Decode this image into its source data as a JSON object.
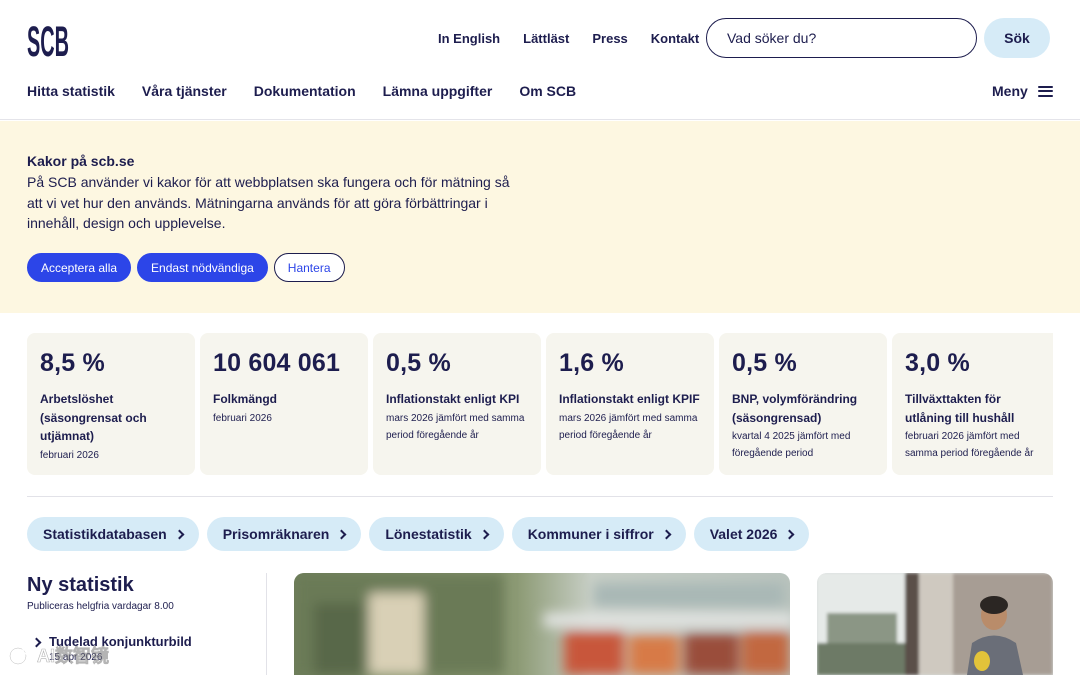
{
  "header": {
    "logo_text": "SCB",
    "top_links": [
      "In English",
      "Lättläst",
      "Press",
      "Kontakt"
    ],
    "search": {
      "placeholder": "Vad söker du?",
      "button": "Sök"
    },
    "nav": [
      "Hitta statistik",
      "Våra tjänster",
      "Dokumentation",
      "Lämna uppgifter",
      "Om SCB"
    ],
    "menu_label": "Meny"
  },
  "cookie": {
    "title": "Kakor på scb.se",
    "text": "På SCB använder vi kakor för att webbplatsen ska fungera och för mätning så att vi vet hur den används. Mätningarna används för att göra förbättringar i innehåll, design och upplevelse.",
    "buttons": [
      "Acceptera alla",
      "Endast nödvändiga",
      "Hantera"
    ]
  },
  "stats": [
    {
      "value": "8,5 %",
      "label": "Arbetslöshet (säsongrensat och utjämnat)",
      "sub": "februari 2026"
    },
    {
      "value": "10 604 061",
      "label": "Folkmängd",
      "sub": "februari 2026"
    },
    {
      "value": "0,5 %",
      "label": "Inflationstakt enligt KPI",
      "sub": "mars 2026 jämfört med samma period föregående år"
    },
    {
      "value": "1,6 %",
      "label": "Inflationstakt enligt KPIF",
      "sub": "mars 2026 jämfört med samma period föregående år"
    },
    {
      "value": "0,5 %",
      "label": "BNP, volymförändring (säsongrensad)",
      "sub": "kvartal 4 2025 jämfört med föregående period"
    },
    {
      "value": "3,0 %",
      "label": "Tillväxttakten för utlåning till hushåll",
      "sub": "februari 2026 jämfört med samma period föregående år"
    }
  ],
  "quick_links": [
    "Statistikdatabasen",
    "Prisomräknaren",
    "Lönestatistik",
    "Kommuner i siffror",
    "Valet 2026"
  ],
  "news": {
    "title": "Ny statistik",
    "subtitle": "Publiceras helgfria vardagar 8.00",
    "items": [
      {
        "title": "Tudelad konjunkturbild",
        "date": "15 apr 2026"
      }
    ]
  },
  "watermark": {
    "text": "AI数智镜"
  },
  "colors": {
    "navy": "#1d1d4e",
    "primary_blue": "#2c45e8",
    "light_blue": "#d6ebf7",
    "banner_bg": "#fdf7e1",
    "card_bg": "#f6f5ee"
  }
}
